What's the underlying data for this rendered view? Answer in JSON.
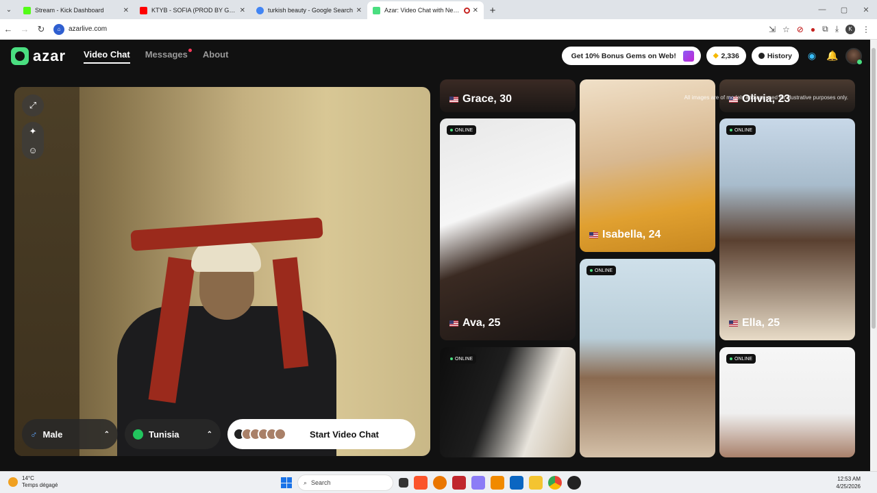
{
  "browser": {
    "tabs": [
      {
        "title": "Stream - Kick Dashboard",
        "color": "#53fc18",
        "active": false
      },
      {
        "title": "KTYB - SOFIA (PROD BY GAL3Y...",
        "color": "#ff0000",
        "active": false
      },
      {
        "title": "turkish beauty - Google Search",
        "color": "#4285f4",
        "active": false
      },
      {
        "title": "Azar: Video Chat with New...",
        "color": "#4ade80",
        "active": true
      }
    ],
    "url": "azarlive.com"
  },
  "header": {
    "logo": "azar",
    "nav": [
      {
        "label": "Video Chat",
        "active": true
      },
      {
        "label": "Messages",
        "active": false,
        "dot": true
      },
      {
        "label": "About",
        "active": false
      }
    ],
    "bonus_label": "Get 10% Bonus Gems on Web!",
    "gems": "2,336",
    "history_label": "History"
  },
  "video": {
    "gender_label": "Male",
    "country_label": "Tunisia",
    "start_label": "Start Video Chat"
  },
  "disclaimer": "All images are of models and are used for illustrative purposes only.",
  "profiles": [
    {
      "name": "Grace, 30",
      "online": false
    },
    {
      "name": "Olivia, 23",
      "online": false
    },
    {
      "name": "Ava, 25",
      "online": true
    },
    {
      "name": "Isabella, 24",
      "online": false
    },
    {
      "name": "Ella, 25",
      "online": true
    },
    {
      "name": "",
      "online": true
    },
    {
      "name": "",
      "online": true
    },
    {
      "name": "",
      "online": true
    }
  ],
  "online_label": "ONLINE",
  "taskbar": {
    "temp": "14°C",
    "weather": "Temps dégagé",
    "search_placeholder": "Search",
    "time": "12:53 AM",
    "date": "4/25/2026"
  }
}
